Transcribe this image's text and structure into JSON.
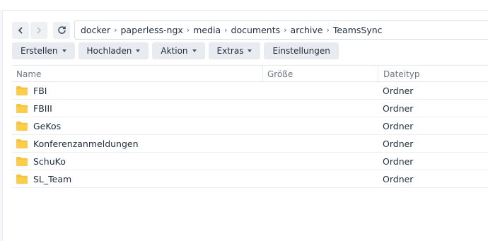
{
  "navigation": {
    "back_icon": "chevron-left-icon",
    "forward_icon": "chevron-right-icon",
    "refresh_icon": "refresh-icon",
    "breadcrumb": [
      "docker",
      "paperless-ngx",
      "media",
      "documents",
      "archive",
      "TeamsSync"
    ]
  },
  "toolbar": {
    "create_label": "Erstellen",
    "upload_label": "Hochladen",
    "action_label": "Aktion",
    "extras_label": "Extras",
    "settings_label": "Einstellungen"
  },
  "table": {
    "columns": {
      "name": "Name",
      "size": "Größe",
      "type": "Dateityp"
    },
    "rows": [
      {
        "name": "FBI",
        "size": "",
        "type": "Ordner",
        "icon": "folder-icon"
      },
      {
        "name": "FBIII",
        "size": "",
        "type": "Ordner",
        "icon": "folder-icon"
      },
      {
        "name": "GeKos",
        "size": "",
        "type": "Ordner",
        "icon": "folder-icon"
      },
      {
        "name": "Konferenzanmeldungen",
        "size": "",
        "type": "Ordner",
        "icon": "folder-icon"
      },
      {
        "name": "SchuKo",
        "size": "",
        "type": "Ordner",
        "icon": "folder-icon"
      },
      {
        "name": "SL_Team",
        "size": "",
        "type": "Ordner",
        "icon": "folder-icon"
      }
    ]
  },
  "colors": {
    "folder": "#f8c33a",
    "button_bg": "#e8ebef",
    "border": "#e6e9ed"
  }
}
